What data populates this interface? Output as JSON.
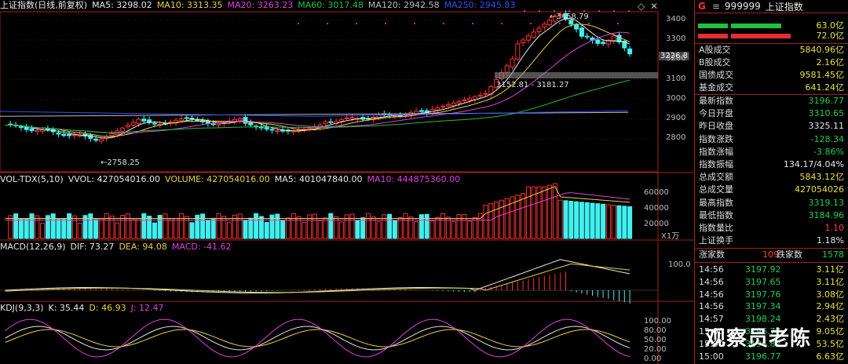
{
  "price_legend": {
    "title": "上证指数(日线,前复权)",
    "ma5": "MA5: 3298.02",
    "ma10": "MA10: 3313.35",
    "ma20": "MA20: 3263.23",
    "ma60": "MA60: 3017.48",
    "ma120": "MA120: 2942.58",
    "ma250": "MA250: 2945.83"
  },
  "vol_legend": {
    "name": "VOL-TDX(5,10)",
    "vvol": "VVOL: 427054016.00",
    "volume": "VOLUME: 427054016.00",
    "ma5": "MA5: 401047840.00",
    "ma10": "MA10: 444875360.00"
  },
  "macd_legend": {
    "name": "MACD(12,26,9)",
    "dif": "DIF: 73.27",
    "dea": "DEA: 94.08",
    "macd": "MACD: -41.62"
  },
  "kdj_legend": {
    "name": "KDJ(9,3,3)",
    "k": "K: 35.44",
    "d": "D: 46.93",
    "j": "J: 12.47"
  },
  "annotations": {
    "high": "3458.79",
    "low": "2758.25",
    "range": "3152.81 - 3181.27",
    "current": "3226.8"
  },
  "axes": {
    "price": [
      "3400",
      "3300",
      "3200",
      "3100",
      "3000",
      "2900",
      "2800"
    ],
    "volume": [
      "60000",
      "40000",
      "20000"
    ],
    "volume_unit": "X1万",
    "macd": [
      "100.0"
    ],
    "kdj": [
      "100.00",
      "80.00",
      "50.00",
      "20.00",
      "0.00"
    ]
  },
  "header": {
    "badge": "G",
    "menu": "≡",
    "code": "999999",
    "name": "上证指数",
    "bar1": "63.0亿",
    "bar2": "72.0亿"
  },
  "stats_top": [
    {
      "label": "A股成交",
      "value": "5840.96亿"
    },
    {
      "label": "B股成交",
      "value": "2.16亿"
    },
    {
      "label": "国债成交",
      "value": "9581.45亿"
    },
    {
      "label": "基金成交",
      "value": "641.24亿"
    }
  ],
  "stats_main": [
    {
      "label": "最新指数",
      "value": "3196.77",
      "tone": "dn"
    },
    {
      "label": "今日开盘",
      "value": "3310.65",
      "tone": "dn"
    },
    {
      "label": "昨日收盘",
      "value": "3325.11",
      "tone": "wt"
    },
    {
      "label": "指数涨跌",
      "value": "-128.34",
      "tone": "dn"
    },
    {
      "label": "指数涨幅",
      "value": "-3.86%",
      "tone": "dn"
    },
    {
      "label": "指数振幅",
      "value": "134.17/4.04%",
      "tone": "wt"
    },
    {
      "label": "总成交额",
      "value": "5843.12亿",
      "tone": "yl"
    },
    {
      "label": "总成交量",
      "value": "427054026",
      "tone": "yl"
    },
    {
      "label": "最高指数",
      "value": "3319.13",
      "tone": "dn"
    },
    {
      "label": "最低指数",
      "value": "3184.96",
      "tone": "dn"
    },
    {
      "label": "指数量比",
      "value": "1.10",
      "tone": "up"
    },
    {
      "label": "上证换手",
      "value": "1.18%",
      "tone": "wt"
    }
  ],
  "breadth": {
    "up_label": "涨家数",
    "up_count": "109",
    "down_label": "跌家数",
    "down_count": "1578"
  },
  "ticks": [
    {
      "time": "14:56",
      "price": "3197.92",
      "value": "3.11亿"
    },
    {
      "time": "14:56",
      "price": "3197.65",
      "value": "3.11亿"
    },
    {
      "time": "14:56",
      "price": "3197.76",
      "value": "3.08亿"
    },
    {
      "time": "14:56",
      "price": "3197.34",
      "value": "2.94亿"
    },
    {
      "time": "14:57",
      "price": "3198.24",
      "value": "2.43亿"
    },
    {
      "time": "15:00",
      "price": "3196.77",
      "value": "9.05亿"
    },
    {
      "time": "15:00",
      "price": "3196.82",
      "value": "53.5亿"
    },
    {
      "time": "15:00",
      "price": "3196.77",
      "value": "6.63亿"
    }
  ],
  "watermark": "观察员老陈",
  "colors": {
    "up": "#ff3030",
    "down": "#40f0f0",
    "bg": "#000000"
  }
}
